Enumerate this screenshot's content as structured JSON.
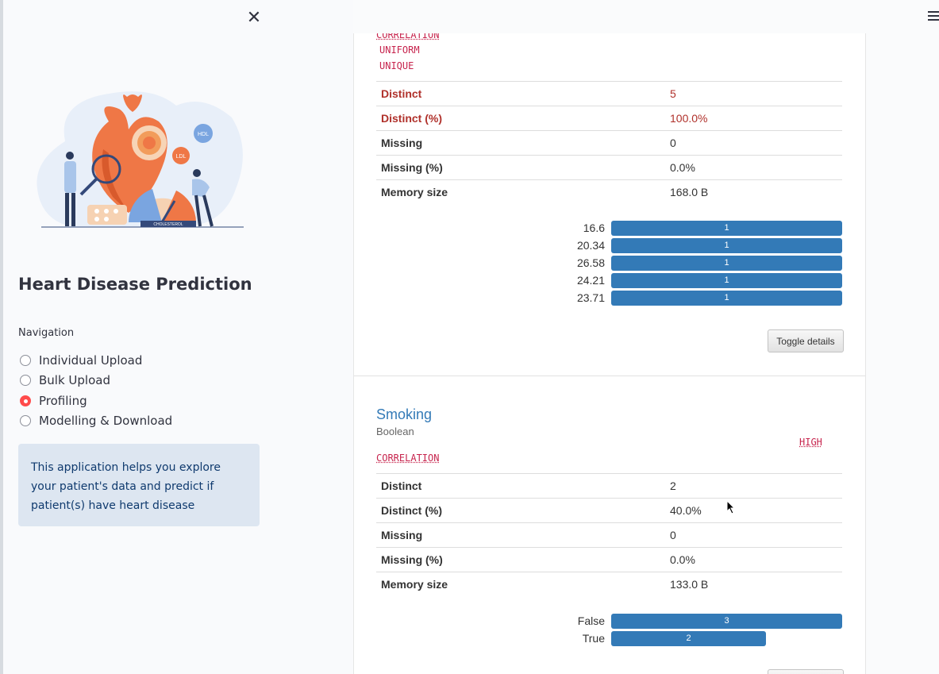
{
  "sidebar": {
    "title": "Heart Disease Prediction",
    "nav_label": "Navigation",
    "nav_items": [
      {
        "label": "Individual Upload",
        "selected": false
      },
      {
        "label": "Bulk Upload",
        "selected": false
      },
      {
        "label": "Profiling",
        "selected": true
      },
      {
        "label": "Modelling & Download",
        "selected": false
      }
    ],
    "info": "This application helps you explore your patient's data and predict if patient(s) have heart disease",
    "hero_label": "CHOLESTEROL",
    "hero_hdl": "HDL",
    "hero_ldl": "LDL"
  },
  "variable1": {
    "alerts": [
      "CORRELATION",
      "UNIFORM",
      "UNIQUE"
    ],
    "stats": [
      {
        "key": "Distinct",
        "value": "5",
        "alert": true
      },
      {
        "key": "Distinct (%)",
        "value": "100.0%",
        "alert": true
      },
      {
        "key": "Missing",
        "value": "0",
        "alert": false
      },
      {
        "key": "Missing (%)",
        "value": "0.0%",
        "alert": false
      },
      {
        "key": "Memory size",
        "value": "168.0 B",
        "alert": false
      }
    ],
    "freq": [
      {
        "label": "16.6",
        "count": "1",
        "fraction": 1.0
      },
      {
        "label": "20.34",
        "count": "1",
        "fraction": 1.0
      },
      {
        "label": "26.58",
        "count": "1",
        "fraction": 1.0
      },
      {
        "label": "24.21",
        "count": "1",
        "fraction": 1.0
      },
      {
        "label": "23.71",
        "count": "1",
        "fraction": 1.0
      }
    ],
    "toggle_label": "Toggle details"
  },
  "variable2": {
    "name": "Smoking",
    "type": "Boolean",
    "alert_high": "HIGH",
    "alert_corr": "CORRELATION",
    "stats": [
      {
        "key": "Distinct",
        "value": "2",
        "alert": false
      },
      {
        "key": "Distinct (%)",
        "value": "40.0%",
        "alert": false
      },
      {
        "key": "Missing",
        "value": "0",
        "alert": false
      },
      {
        "key": "Missing (%)",
        "value": "0.0%",
        "alert": false
      },
      {
        "key": "Memory size",
        "value": "133.0 B",
        "alert": false
      }
    ],
    "freq": [
      {
        "label": "False",
        "count": "3",
        "fraction": 1.0
      },
      {
        "label": "True",
        "count": "2",
        "fraction": 0.667
      }
    ]
  },
  "colors": {
    "accent": "#ff4b4b",
    "bar": "#337ab7",
    "alert": "#b0312b"
  },
  "icons": {
    "close": "close-icon",
    "menu": "hamburger-menu-icon"
  }
}
